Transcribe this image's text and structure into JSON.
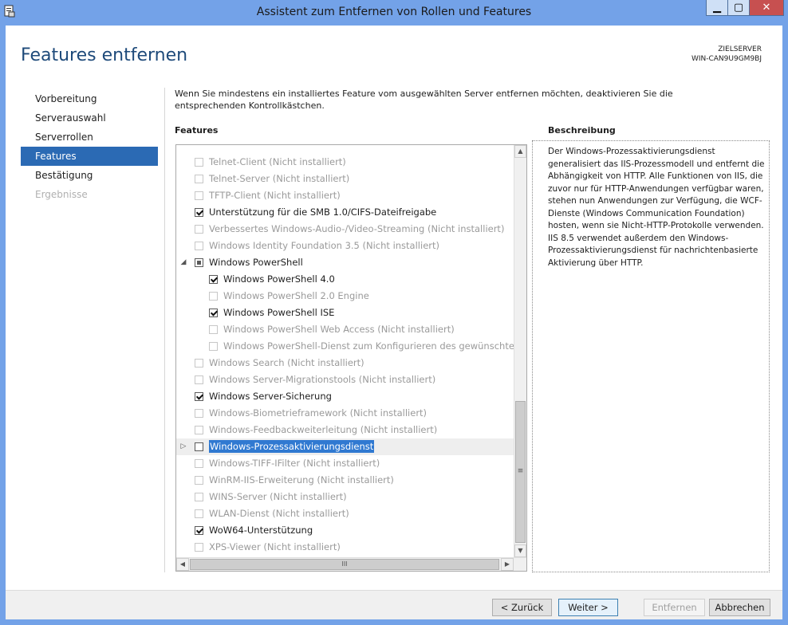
{
  "window": {
    "title": "Assistent zum Entfernen von Rollen und Features",
    "controls": {
      "minimize": "▁",
      "maximize": "▢",
      "close": "✕"
    }
  },
  "header": {
    "page_title": "Features entfernen",
    "server_label": "ZIELSERVER",
    "server_name": "WIN-CAN9U9GM9BJ"
  },
  "nav": {
    "items": [
      {
        "label": "Vorbereitung",
        "state": "normal"
      },
      {
        "label": "Serverauswahl",
        "state": "normal"
      },
      {
        "label": "Serverrollen",
        "state": "normal"
      },
      {
        "label": "Features",
        "state": "active"
      },
      {
        "label": "Bestätigung",
        "state": "normal"
      },
      {
        "label": "Ergebnisse",
        "state": "disabled"
      }
    ]
  },
  "intro": "Wenn Sie mindestens ein installiertes Feature vom ausgewählten Server entfernen möchten, deaktivieren Sie die entsprechenden Kontrollkästchen.",
  "features": {
    "heading": "Features",
    "rows": [
      {
        "label": "Telnet-Client (Nicht installiert)",
        "checked": false,
        "disabled": true,
        "indent": 0
      },
      {
        "label": "Telnet-Server (Nicht installiert)",
        "checked": false,
        "disabled": true,
        "indent": 0
      },
      {
        "label": "TFTP-Client (Nicht installiert)",
        "checked": false,
        "disabled": true,
        "indent": 0
      },
      {
        "label": "Unterstützung für die SMB 1.0/CIFS-Dateifreigabe",
        "checked": true,
        "disabled": false,
        "indent": 0
      },
      {
        "label": "Verbessertes Windows-Audio-/Video-Streaming (Nicht installiert)",
        "checked": false,
        "disabled": true,
        "indent": 0
      },
      {
        "label": "Windows Identity Foundation 3.5 (Nicht installiert)",
        "checked": false,
        "disabled": true,
        "indent": 0
      },
      {
        "label": "Windows PowerShell",
        "checked": "partial",
        "disabled": false,
        "indent": 0,
        "expander": "◢"
      },
      {
        "label": "Windows PowerShell 4.0",
        "checked": true,
        "disabled": false,
        "indent": 1
      },
      {
        "label": "Windows PowerShell 2.0 Engine",
        "checked": false,
        "disabled": true,
        "indent": 1
      },
      {
        "label": "Windows PowerShell ISE",
        "checked": true,
        "disabled": false,
        "indent": 1
      },
      {
        "label": "Windows PowerShell Web Access (Nicht installiert)",
        "checked": false,
        "disabled": true,
        "indent": 1
      },
      {
        "label": "Windows PowerShell-Dienst zum Konfigurieren des gewünschten Zu",
        "checked": false,
        "disabled": true,
        "indent": 1
      },
      {
        "label": "Windows Search (Nicht installiert)",
        "checked": false,
        "disabled": true,
        "indent": 0
      },
      {
        "label": "Windows Server-Migrationstools (Nicht installiert)",
        "checked": false,
        "disabled": true,
        "indent": 0
      },
      {
        "label": "Windows Server-Sicherung",
        "checked": true,
        "disabled": false,
        "indent": 0
      },
      {
        "label": "Windows-Biometrieframework (Nicht installiert)",
        "checked": false,
        "disabled": true,
        "indent": 0
      },
      {
        "label": "Windows-Feedbackweiterleitung (Nicht installiert)",
        "checked": false,
        "disabled": true,
        "indent": 0
      },
      {
        "label": "Windows-Prozessaktivierungsdienst",
        "checked": false,
        "disabled": false,
        "indent": 0,
        "expander": "▷",
        "selected": true
      },
      {
        "label": "Windows-TIFF-IFilter (Nicht installiert)",
        "checked": false,
        "disabled": true,
        "indent": 0
      },
      {
        "label": "WinRM-IIS-Erweiterung (Nicht installiert)",
        "checked": false,
        "disabled": true,
        "indent": 0
      },
      {
        "label": "WINS-Server (Nicht installiert)",
        "checked": false,
        "disabled": true,
        "indent": 0
      },
      {
        "label": "WLAN-Dienst (Nicht installiert)",
        "checked": false,
        "disabled": true,
        "indent": 0
      },
      {
        "label": "WoW64-Unterstützung",
        "checked": true,
        "disabled": false,
        "indent": 0
      },
      {
        "label": "XPS-Viewer (Nicht installiert)",
        "checked": false,
        "disabled": true,
        "indent": 0
      }
    ],
    "scroll": {
      "up": "▲",
      "down": "▼",
      "left": "◀",
      "right": "▶",
      "vgrip": "≡",
      "hgrip": "III"
    }
  },
  "description": {
    "heading": "Beschreibung",
    "text": "Der Windows-Prozessaktivierungsdienst generalisiert das IIS-Prozessmodell und entfernt die Abhängigkeit von HTTP. Alle Funktionen von IIS, die zuvor nur für HTTP-Anwendungen verfügbar waren, stehen nun Anwendungen zur Verfügung, die WCF-Dienste (Windows Communication Foundation) hosten, wenn sie Nicht-HTTP-Protokolle verwenden. IIS 8.5 verwendet außerdem den Windows-Prozessaktivierungsdienst für nachrichtenbasierte Aktivierung über HTTP."
  },
  "footer": {
    "back": "< Zurück",
    "next": "Weiter >",
    "remove": "Entfernen",
    "cancel": "Abbrechen"
  },
  "colors": {
    "titlebar": "#73a2e8",
    "nav_active": "#2b6ab4",
    "selection": "#3079d1",
    "page_title": "#1e4a7a"
  }
}
